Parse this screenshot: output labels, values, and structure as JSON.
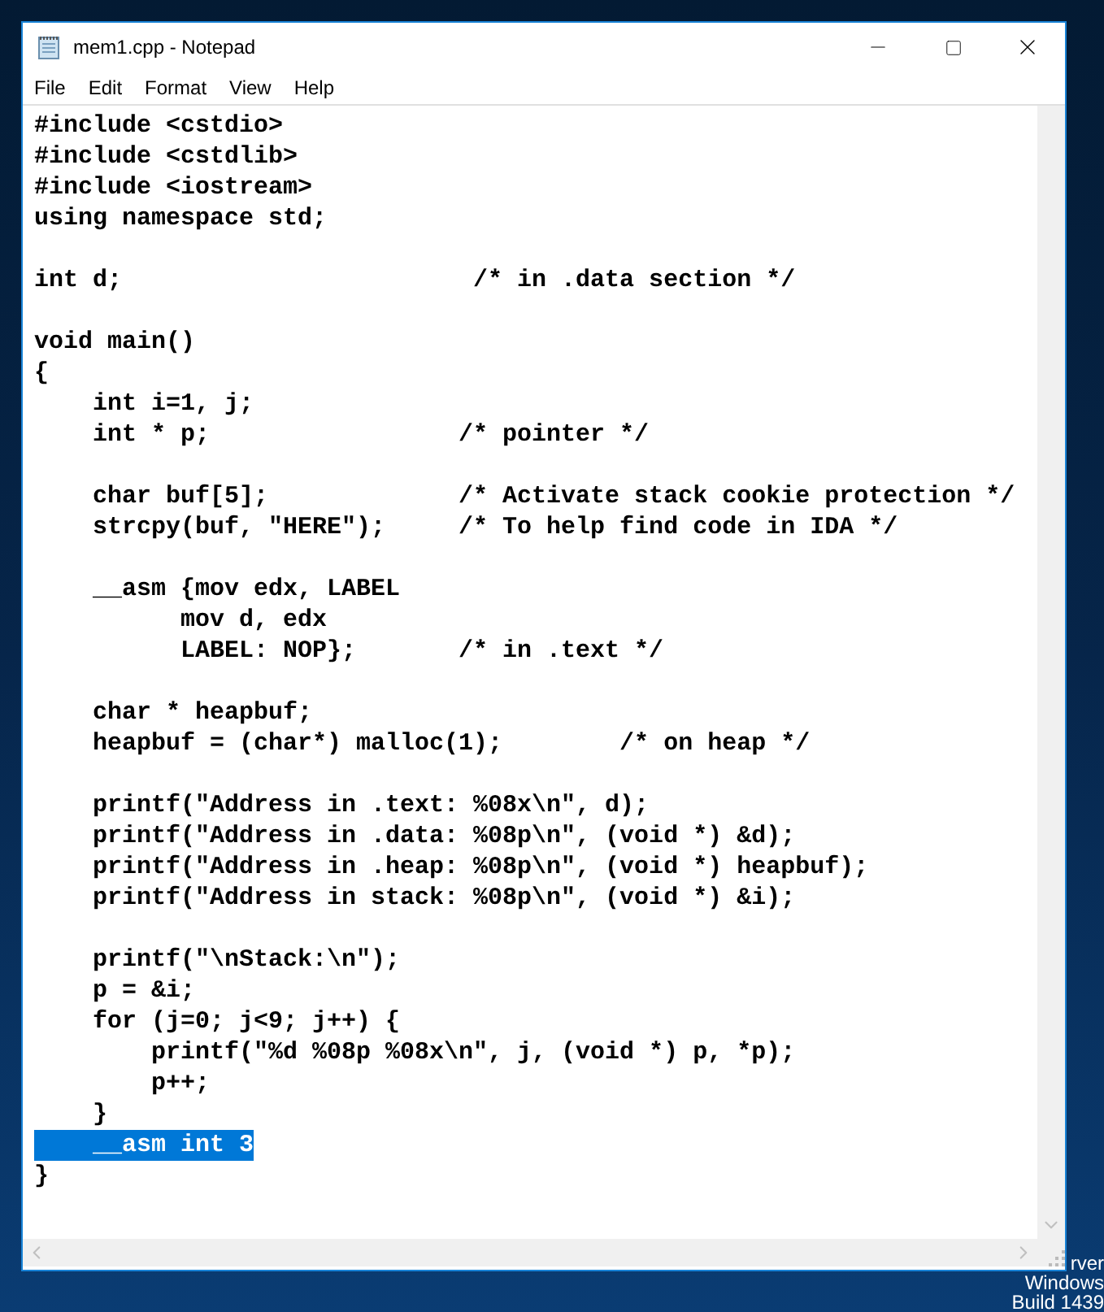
{
  "window": {
    "title": "mem1.cpp - Notepad"
  },
  "menu": [
    "File",
    "Edit",
    "Format",
    "View",
    "Help"
  ],
  "editor": {
    "lines": [
      {
        "kind": "code",
        "text": "#include <cstdio>",
        "selected": false
      },
      {
        "kind": "code",
        "text": "#include <cstdlib>",
        "selected": false
      },
      {
        "kind": "code",
        "text": "#include <iostream>",
        "selected": false
      },
      {
        "kind": "code",
        "text": "using namespace std;",
        "selected": false
      },
      {
        "kind": "blank"
      },
      {
        "kind": "code",
        "text": "int d;                        /* in .data section */",
        "selected": false
      },
      {
        "kind": "blank"
      },
      {
        "kind": "code",
        "text": "void main()",
        "selected": false
      },
      {
        "kind": "code",
        "text": "{",
        "selected": false
      },
      {
        "kind": "code",
        "text": "    int i=1, j;",
        "selected": false
      },
      {
        "kind": "code",
        "text": "    int * p;                 /* pointer */",
        "selected": false
      },
      {
        "kind": "blank"
      },
      {
        "kind": "code",
        "text": "    char buf[5];             /* Activate stack cookie protection */",
        "selected": false
      },
      {
        "kind": "code",
        "text": "    strcpy(buf, \"HERE\");     /* To help find code in IDA */",
        "selected": false
      },
      {
        "kind": "blank"
      },
      {
        "kind": "code",
        "text": "    __asm {mov edx, LABEL",
        "selected": false
      },
      {
        "kind": "code",
        "text": "          mov d, edx",
        "selected": false
      },
      {
        "kind": "code",
        "text": "          LABEL: NOP};       /* in .text */",
        "selected": false
      },
      {
        "kind": "blank"
      },
      {
        "kind": "code",
        "text": "    char * heapbuf;",
        "selected": false
      },
      {
        "kind": "code",
        "text": "    heapbuf = (char*) malloc(1);        /* on heap */",
        "selected": false
      },
      {
        "kind": "blank"
      },
      {
        "kind": "code",
        "text": "    printf(\"Address in .text: %08x\\n\", d);",
        "selected": false
      },
      {
        "kind": "code",
        "text": "    printf(\"Address in .data: %08p\\n\", (void *) &d);",
        "selected": false
      },
      {
        "kind": "code",
        "text": "    printf(\"Address in .heap: %08p\\n\", (void *) heapbuf);",
        "selected": false
      },
      {
        "kind": "code",
        "text": "    printf(\"Address in stack: %08p\\n\", (void *) &i);",
        "selected": false
      },
      {
        "kind": "blank"
      },
      {
        "kind": "code",
        "text": "    printf(\"\\nStack:\\n\");",
        "selected": false
      },
      {
        "kind": "code",
        "text": "    p = &i;",
        "selected": false
      },
      {
        "kind": "code",
        "text": "    for (j=0; j<9; j++) {",
        "selected": false
      },
      {
        "kind": "code",
        "text": "        printf(\"%d %08p %08x\\n\", j, (void *) p, *p);",
        "selected": false
      },
      {
        "kind": "code",
        "text": "        p++;",
        "selected": false
      },
      {
        "kind": "code",
        "text": "    }",
        "selected": false
      },
      {
        "kind": "code",
        "text": "    __asm int 3",
        "selected": true
      },
      {
        "kind": "code",
        "text": "}",
        "selected": false
      }
    ]
  },
  "desktop_text": [
    "rver",
    "Windows",
    "Build 1439"
  ]
}
